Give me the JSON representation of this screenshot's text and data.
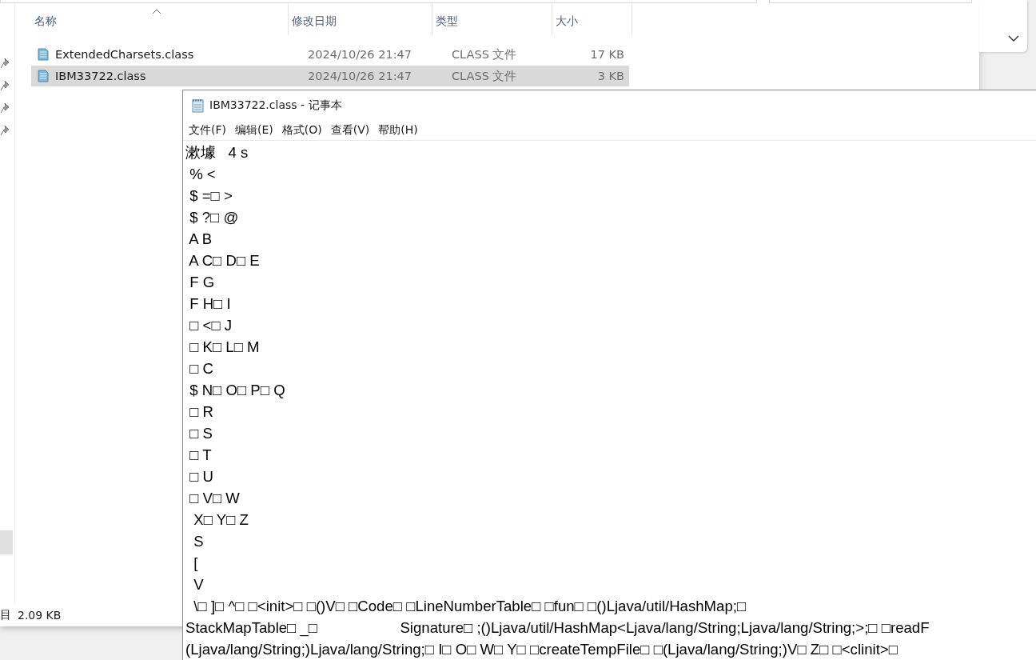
{
  "explorer": {
    "columns": [
      {
        "label": "名称",
        "sorted": true
      },
      {
        "label": "修改日期",
        "sorted": false
      },
      {
        "label": "类型",
        "sorted": false
      },
      {
        "label": "大小",
        "sorted": false
      }
    ],
    "files": [
      {
        "name": "ExtendedCharsets.class",
        "modified": "2024/10/26 21:47",
        "type": "CLASS 文件",
        "size": "17 KB",
        "selected": false
      },
      {
        "name": "IBM33722.class",
        "modified": "2024/10/26 21:47",
        "type": "CLASS 文件",
        "size": "3 KB",
        "selected": true
      }
    ],
    "status_bar": {
      "item_count_fragment": "目",
      "selection_size": "2.09 KB"
    }
  },
  "notepad": {
    "title": "IBM33722.class - 记事本",
    "menu": [
      "文件(F)",
      "编辑(E)",
      "格式(O)",
      "查看(V)",
      "帮助(H)"
    ],
    "lines": [
      "漱壉   4 s",
      " % <",
      " $ =□ >",
      " $ ?□ @",
      " A B",
      " A C□ D□ E",
      " F G",
      " F H□ I",
      " □ <□ J",
      " □ K□ L□ M",
      " □ C",
      " $ N□ O□ P□ Q",
      " □ R",
      " □ S",
      " □ T",
      " □ U",
      " □ V□ W",
      "  X□ Y□ Z",
      "  S",
      "  [",
      "  V",
      "  \\□ ]□ ^□ □<init>□ □()V□ □Code□ □LineNumberTable□ □fun□ □()Ljava/util/HashMap;□",
      "StackMapTable□ _□                    Signature□ ;()Ljava/util/HashMap<Ljava/lang/String;Ljava/lang/String;>;□ □readF",
      "(Ljava/lang/String;)Ljava/lang/String;□ I□ O□ W□ Y□ □createTempFile□ □(Ljava/lang/String;)V□ Z□ □<clinit>□"
    ]
  }
}
